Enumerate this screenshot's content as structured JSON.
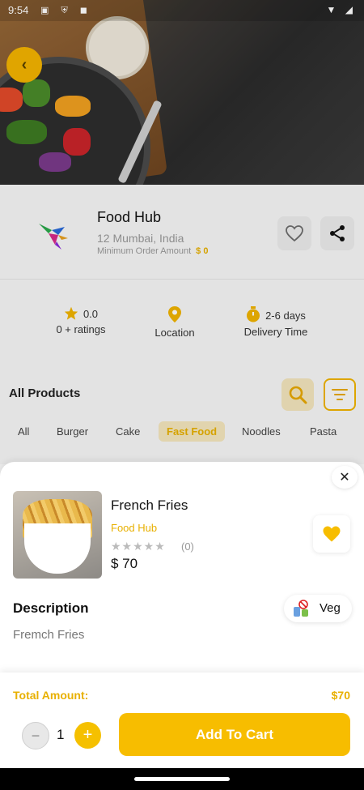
{
  "status_bar": {
    "time": "9:54",
    "left_icons": "▣ ⛨ ◼",
    "right_icons": "▼ ◢"
  },
  "banner": {
    "back_icon": "chevron-left-icon"
  },
  "restaurant": {
    "name": "Food Hub",
    "address": "12 Mumbai, India",
    "min_order_label": "Minimum Order Amount",
    "min_order_value": "$ 0",
    "favorite_icon": "heart-outline-icon",
    "share_icon": "share-icon"
  },
  "stats": [
    {
      "icon": "star-icon",
      "value": "0.0",
      "label": "0 + ratings"
    },
    {
      "icon": "location-pin-icon",
      "value": "",
      "label": "Location"
    },
    {
      "icon": "timer-icon",
      "value": "2-6 days",
      "label": "Delivery Time"
    }
  ],
  "products_section": {
    "title": "All Products",
    "search_icon": "search-icon",
    "filter_icon": "filter-icon",
    "categories": [
      "All",
      "Burger",
      "Cake",
      "Fast Food",
      "Noodles",
      "Pasta"
    ],
    "active_category": "Fast Food"
  },
  "product_sheet": {
    "close_icon": "close-icon",
    "name": "French Fries",
    "vendor": "Food Hub",
    "rating_stars": "★★★★★",
    "rating_count": "(0)",
    "price": "$ 70",
    "favorite_icon": "heart-filled-icon",
    "description_title": "Description",
    "description": "Fremch Fries",
    "diet_label": "Veg"
  },
  "cart_footer": {
    "total_label": "Total Amount:",
    "total_value": "$70",
    "minus": "−",
    "quantity": "1",
    "plus": "+",
    "add_label": "Add To Cart"
  },
  "colors": {
    "accent": "#F7BD00",
    "accent_text": "#E8B000"
  }
}
